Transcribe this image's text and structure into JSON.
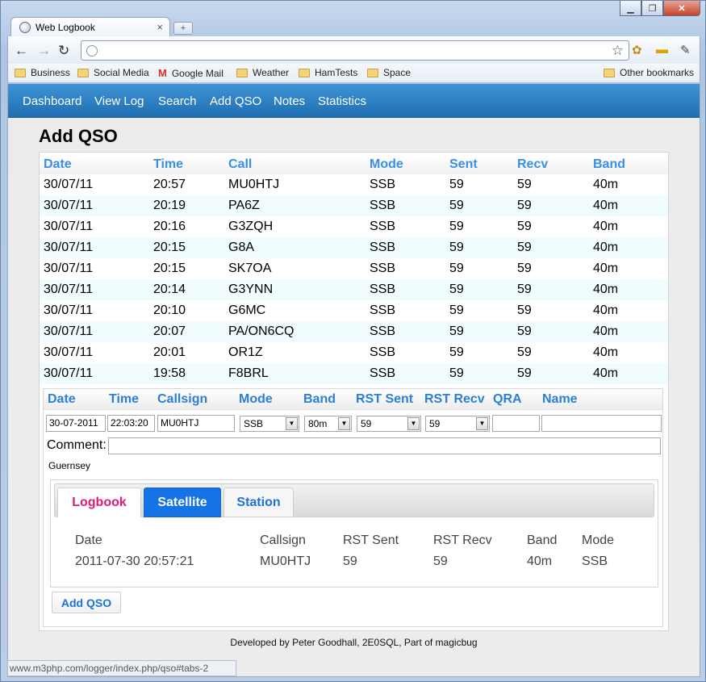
{
  "window": {
    "min_label": "▁",
    "max_label": "❐",
    "close_label": "✕"
  },
  "tab": {
    "title": "Web Logbook",
    "close": "×",
    "newtab": "+"
  },
  "toolbar": {
    "back": "←",
    "forward": "→",
    "reload": "↻",
    "address": "",
    "star": "☆"
  },
  "bookmarks": {
    "items": [
      "Business",
      "Social Media",
      "Google Mail",
      "Weather",
      "HamTests",
      "Space"
    ],
    "other": "Other bookmarks"
  },
  "menu": {
    "items": [
      "Dashboard",
      "View Log",
      "Search",
      "Add QSO",
      "Notes",
      "Statistics"
    ]
  },
  "page": {
    "title": "Add QSO"
  },
  "log": {
    "headers": [
      "Date",
      "Time",
      "Call",
      "Mode",
      "Sent",
      "Recv",
      "Band"
    ],
    "rows": [
      [
        "30/07/11",
        "20:57",
        "MU0HTJ",
        "SSB",
        "59",
        "59",
        "40m"
      ],
      [
        "30/07/11",
        "20:19",
        "PA6Z",
        "SSB",
        "59",
        "59",
        "40m"
      ],
      [
        "30/07/11",
        "20:16",
        "G3ZQH",
        "SSB",
        "59",
        "59",
        "40m"
      ],
      [
        "30/07/11",
        "20:15",
        "G8A",
        "SSB",
        "59",
        "59",
        "40m"
      ],
      [
        "30/07/11",
        "20:15",
        "SK7OA",
        "SSB",
        "59",
        "59",
        "40m"
      ],
      [
        "30/07/11",
        "20:14",
        "G3YNN",
        "SSB",
        "59",
        "59",
        "40m"
      ],
      [
        "30/07/11",
        "20:10",
        "G6MC",
        "SSB",
        "59",
        "59",
        "40m"
      ],
      [
        "30/07/11",
        "20:07",
        "PA/ON6CQ",
        "SSB",
        "59",
        "59",
        "40m"
      ],
      [
        "30/07/11",
        "20:01",
        "OR1Z",
        "SSB",
        "59",
        "59",
        "40m"
      ],
      [
        "30/07/11",
        "19:58",
        "F8BRL",
        "SSB",
        "59",
        "59",
        "40m"
      ]
    ]
  },
  "form": {
    "headers": {
      "date": "Date",
      "time": "Time",
      "callsign": "Callsign",
      "mode": "Mode",
      "band": "Band",
      "rst_sent": "RST Sent",
      "rst_recv": "RST Recv",
      "qra": "QRA",
      "name": "Name"
    },
    "values": {
      "date": "30-07-2011",
      "time": "22:03:20",
      "callsign": "MU0HTJ",
      "mode": "SSB",
      "band": "80m",
      "rst_sent": "59",
      "rst_recv": "59",
      "qra": "",
      "name": ""
    },
    "comment_label": "Comment:",
    "comment": "",
    "location": "Guernsey"
  },
  "tabs": {
    "labels": [
      "Logbook",
      "Satellite",
      "Station"
    ],
    "headers": {
      "date": "Date",
      "callsign": "Callsign",
      "rst_sent": "RST Sent",
      "rst_recv": "RST Recv",
      "band": "Band",
      "mode": "Mode"
    },
    "row": {
      "date": "2011-07-30 20:57:21",
      "callsign": "MU0HTJ",
      "rst_sent": "59",
      "rst_recv": "59",
      "band": "40m",
      "mode": "SSB"
    }
  },
  "add_button": "Add QSO",
  "footer": "Developed by Peter Goodhall, 2E0SQL, Part of magicbug",
  "status_url": "www.m3php.com/logger/index.php/qso#tabs-2",
  "colors": {
    "menubar": "#2a7fc4",
    "link": "#3a8ee6",
    "active_tab": "#1673e6",
    "logbook_tab": "#e0197d"
  }
}
